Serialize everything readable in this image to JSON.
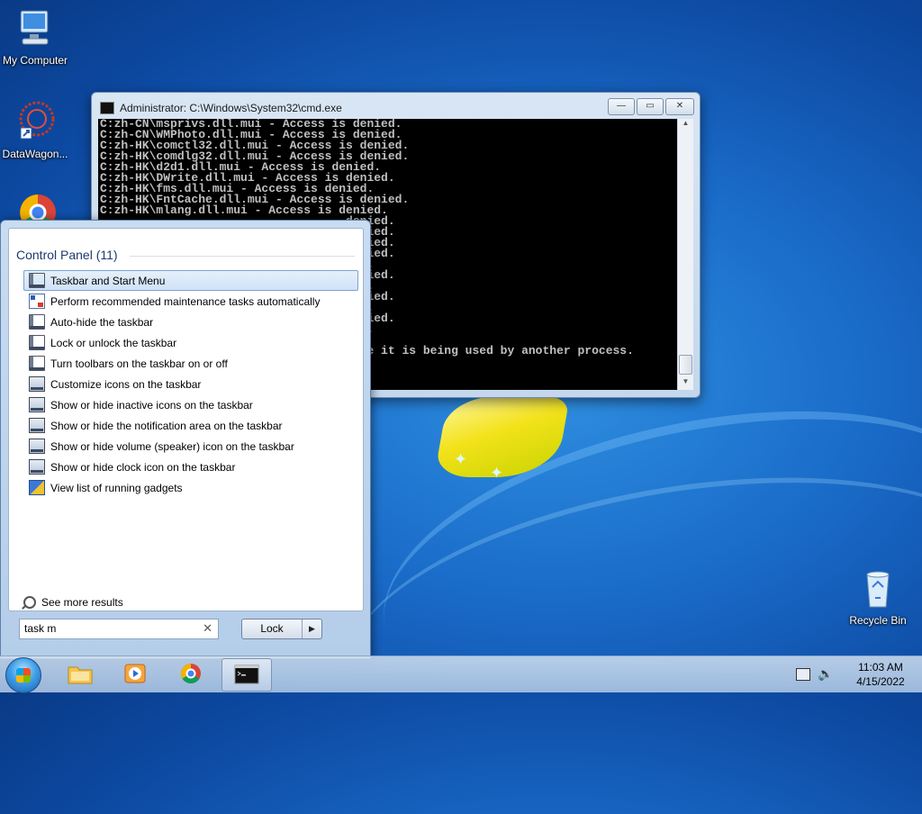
{
  "desktop": {
    "icons": [
      {
        "label": "My Computer"
      },
      {
        "label": "DataWagon..."
      },
      {
        "label": "Recycle Bin"
      }
    ]
  },
  "cmd_window": {
    "title": "Administrator: C:\\Windows\\System32\\cmd.exe",
    "lines": [
      "C:zh-CN\\msprivs.dll.mui - Access is denied.",
      "C:zh-CN\\WMPhoto.dll.mui - Access is denied.",
      "C:zh-HK\\comctl32.dll.mui - Access is denied.",
      "C:zh-HK\\comdlg32.dll.mui - Access is denied.",
      "C:zh-HK\\d2d1.dll.mui - Access is denied.",
      "C:zh-HK\\DWrite.dll.mui - Access is denied.",
      "C:zh-HK\\fms.dll.mui - Access is denied.",
      "C:zh-HK\\FntCache.dll.mui - Access is denied.",
      "C:zh-HK\\mlang.dll.mui - Access is denied.",
      "                                   denied.",
      "                                   denied.",
      "                                   denied.",
      "                                   denied.",
      "                                   ied.",
      "                                   denied.",
      "                                   ied.",
      "                                   denied.",
      "                                   ied.",
      "                                   denied.",
      "                                   ied.",
      "",
      "                                   ause it is being used by another process."
    ],
    "buttons": {
      "minimize": "—",
      "maximize": "▭",
      "close": "✕"
    }
  },
  "start_menu": {
    "group_header": "Control Panel (11)",
    "items": [
      {
        "label": "Taskbar and Start Menu",
        "icon": "taskbar-icon"
      },
      {
        "label": "Perform recommended maintenance tasks automatically",
        "icon": "maintenance-icon"
      },
      {
        "label": "Auto-hide the taskbar",
        "icon": "taskbar-icon"
      },
      {
        "label": "Lock or unlock the taskbar",
        "icon": "taskbar-icon"
      },
      {
        "label": "Turn toolbars on the taskbar on or off",
        "icon": "taskbar-icon"
      },
      {
        "label": "Customize icons on the taskbar",
        "icon": "notification-icon"
      },
      {
        "label": "Show or hide inactive icons on the taskbar",
        "icon": "notification-icon"
      },
      {
        "label": "Show or hide the notification area on the taskbar",
        "icon": "notification-icon"
      },
      {
        "label": "Show or hide volume (speaker) icon on the taskbar",
        "icon": "notification-icon"
      },
      {
        "label": "Show or hide clock icon on the taskbar",
        "icon": "notification-icon"
      },
      {
        "label": "View list of running gadgets",
        "icon": "gadget-icon"
      }
    ],
    "see_more": "See more results",
    "search_value": "task m",
    "lock_label": "Lock",
    "lock_arrow": "▶"
  },
  "taskbar": {
    "time": "11:03 AM",
    "date": "4/15/2022",
    "volume_glyph": "🔈"
  },
  "colors": {
    "accent": "#3f9ee7",
    "desktop_bg": "#1a6cc9"
  }
}
